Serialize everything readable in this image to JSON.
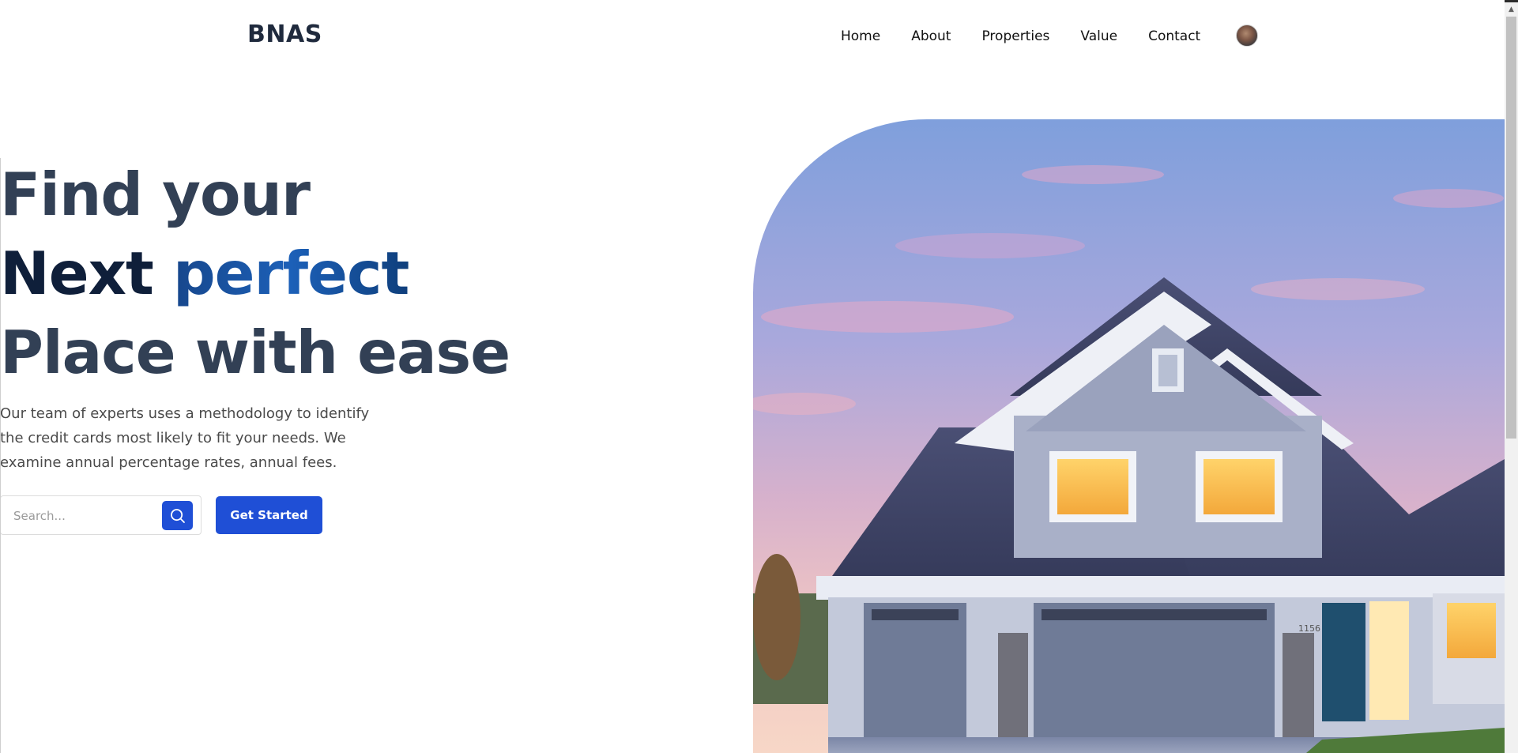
{
  "brand": {
    "name": "BNAS"
  },
  "nav": {
    "items": [
      {
        "label": "Home"
      },
      {
        "label": "About"
      },
      {
        "label": "Properties"
      },
      {
        "label": "Value"
      },
      {
        "label": "Contact"
      }
    ]
  },
  "hero": {
    "title_line1": "Find your",
    "title_line2_a": "Next ",
    "title_line2_b": "perfect",
    "title_line3": "Place with ease",
    "description": "Our team of experts uses a methodology to identify the credit cards most likely to fit your needs. We examine annual percentage rates, annual fees.",
    "search_placeholder": "Search...",
    "cta_label": "Get Started"
  },
  "house_number": "1156",
  "colors": {
    "accent": "#1f4fd6",
    "heading": "#324055",
    "heading_dark": "#0f1f3a",
    "accent_text": "#1c60b8"
  },
  "icons": {
    "search": "search-icon",
    "avatar": "avatar",
    "scroll_up": "scroll-up-arrow-icon"
  }
}
